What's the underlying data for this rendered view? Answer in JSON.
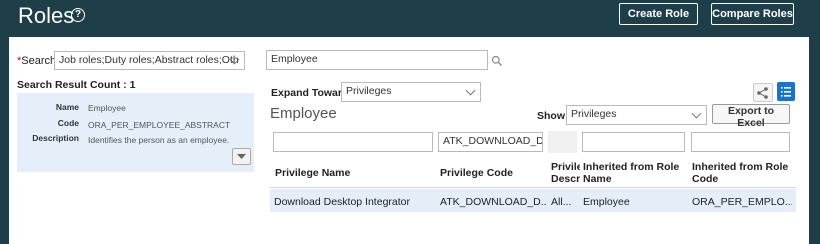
{
  "header": {
    "title": "Roles",
    "help_icon": "?",
    "create_role_label": "Create Role",
    "compare_roles_label": "Compare Roles"
  },
  "search": {
    "label": "Search",
    "required_marker": "*",
    "role_types_value": "Job roles;Duty roles;Abstract roles;Oth",
    "keyword_value": "Employee"
  },
  "results": {
    "count_label": "Search Result Count : 1",
    "card": {
      "name_key": "Name",
      "name_value": "Employee",
      "code_key": "Code",
      "code_value": "ORA_PER_EMPLOYEE_ABSTRACT",
      "description_key": "Description",
      "description_value": "Identifies the person as an employee."
    }
  },
  "detail": {
    "expand_toward_label": "Expand Toward",
    "expand_toward_value": "Privileges",
    "title": "Employee",
    "show_label": "Show",
    "show_value": "Privileges",
    "export_label": "Export to Excel"
  },
  "table": {
    "filters": [
      "",
      "ATK_DOWNLOAD_DES",
      "",
      "",
      ""
    ],
    "columns": [
      {
        "line1": "Privilege Name",
        "line2": ""
      },
      {
        "line1": "Privilege Code",
        "line2": ""
      },
      {
        "line1": "Privile",
        "line2": "Descri"
      },
      {
        "line1": "Inherited from Role",
        "line2": "Name"
      },
      {
        "line1": "Inherited from Role",
        "line2": "Code"
      }
    ],
    "rows": [
      [
        "Download Desktop Integrator",
        "ATK_DOWNLOAD_D...",
        "All...",
        "Employee",
        "ORA_PER_EMPLO..."
      ]
    ]
  },
  "colors": {
    "header_bg": "#1e3e49",
    "card_bg": "#e5eff9",
    "row_selected_bg": "#e4eef9",
    "accent_blue": "#1a73c9"
  }
}
